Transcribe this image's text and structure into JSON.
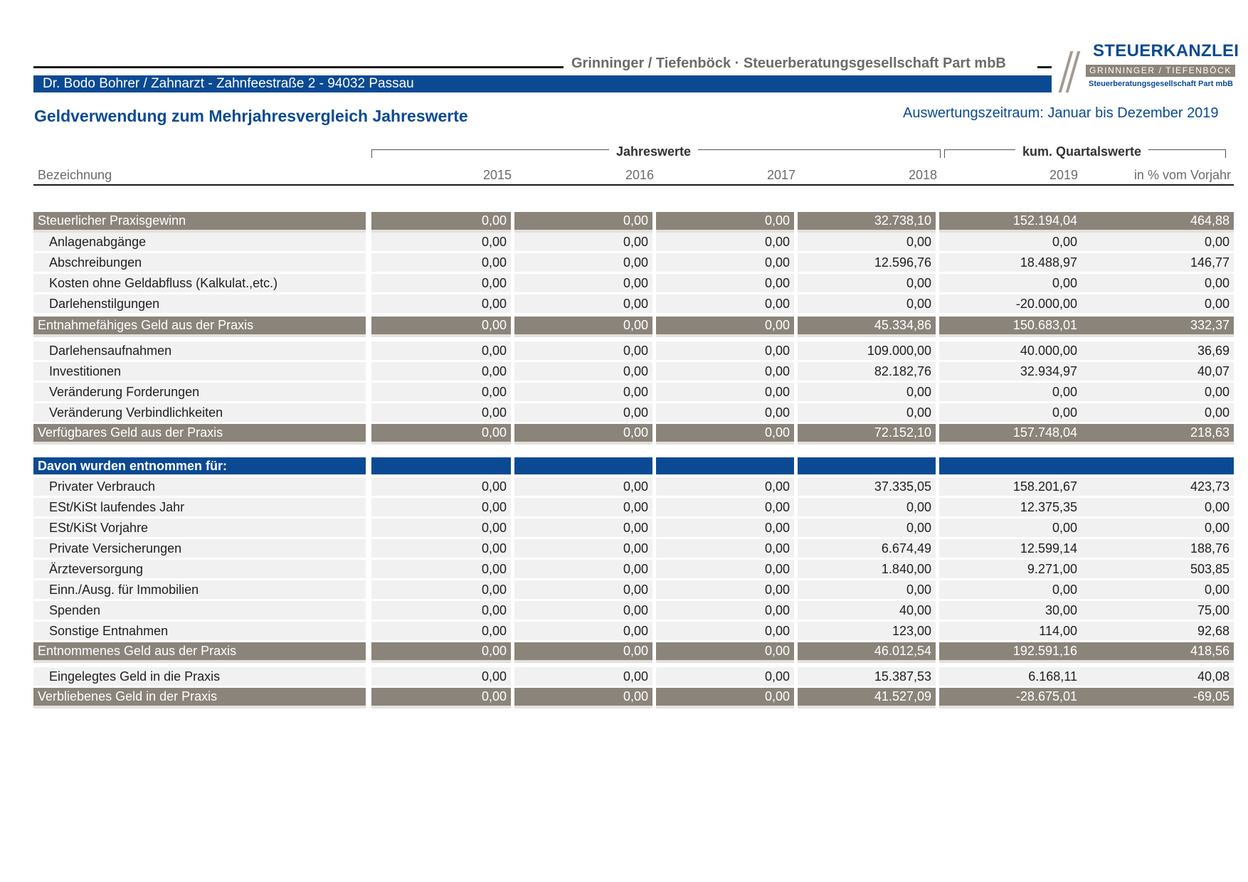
{
  "header": {
    "firm_name": "Grinninger / Tiefenböck · Steuerberatungsgesellschaft Part mbB",
    "client_line": "Dr. Bodo Bohrer / Zahnarzt  -  Zahnfeestraße 2  -  94032 Passau",
    "logo": {
      "title": "STEUERKANZLEI",
      "band": "GRINNINGER / TIEFENBÖCK",
      "sub": "Steuerberatungsgesellschaft Part mbB"
    }
  },
  "report": {
    "title": "Geldverwendung zum Mehrjahresvergleich Jahreswerte",
    "period": "Auswertungszeitraum: Januar bis Dezember 2019"
  },
  "columns": {
    "group_annual": "Jahreswerte",
    "group_quarter": "kum. Quartalswerte",
    "label": "Bezeichnung",
    "years": [
      "2015",
      "2016",
      "2017",
      "2018",
      "2019"
    ],
    "percent": "in % vom Vorjahr"
  },
  "rows": [
    {
      "type": "sum",
      "label": "Steuerlicher Praxisgewinn",
      "values": [
        "0,00",
        "0,00",
        "0,00",
        "32.738,10",
        "152.194,04",
        "464,88"
      ]
    },
    {
      "type": "plain",
      "label": "Anlagenabgänge",
      "values": [
        "0,00",
        "0,00",
        "0,00",
        "0,00",
        "0,00",
        "0,00"
      ]
    },
    {
      "type": "plain",
      "label": "Abschreibungen",
      "values": [
        "0,00",
        "0,00",
        "0,00",
        "12.596,76",
        "18.488,97",
        "146,77"
      ]
    },
    {
      "type": "plain",
      "label": "Kosten ohne Geldabfluss (Kalkulat.,etc.)",
      "values": [
        "0,00",
        "0,00",
        "0,00",
        "0,00",
        "0,00",
        "0,00"
      ]
    },
    {
      "type": "plain",
      "label": "Darlehenstilgungen",
      "values": [
        "0,00",
        "0,00",
        "0,00",
        "0,00",
        "-20.000,00",
        "0,00"
      ]
    },
    {
      "type": "sum",
      "label": "Entnahmefähiges Geld aus der Praxis",
      "values": [
        "0,00",
        "0,00",
        "0,00",
        "45.334,86",
        "150.683,01",
        "332,37"
      ]
    },
    {
      "type": "plain",
      "label": "Darlehensaufnahmen",
      "values": [
        "0,00",
        "0,00",
        "0,00",
        "109.000,00",
        "40.000,00",
        "36,69"
      ]
    },
    {
      "type": "plain",
      "label": "Investitionen",
      "values": [
        "0,00",
        "0,00",
        "0,00",
        "82.182,76",
        "32.934,97",
        "40,07"
      ]
    },
    {
      "type": "plain",
      "label": "Veränderung Forderungen",
      "values": [
        "0,00",
        "0,00",
        "0,00",
        "0,00",
        "0,00",
        "0,00"
      ]
    },
    {
      "type": "plain",
      "label": "Veränderung Verbindlichkeiten",
      "values": [
        "0,00",
        "0,00",
        "0,00",
        "0,00",
        "0,00",
        "0,00"
      ]
    },
    {
      "type": "sum",
      "label": "Verfügbares Geld aus der Praxis",
      "values": [
        "0,00",
        "0,00",
        "0,00",
        "72.152,10",
        "157.748,04",
        "218,63"
      ]
    },
    {
      "type": "section",
      "label": "Davon wurden entnommen für:",
      "values": [
        "",
        "",
        "",
        "",
        "",
        ""
      ]
    },
    {
      "type": "plain",
      "label": "Privater Verbrauch",
      "values": [
        "0,00",
        "0,00",
        "0,00",
        "37.335,05",
        "158.201,67",
        "423,73"
      ]
    },
    {
      "type": "plain",
      "label": "ESt/KiSt laufendes Jahr",
      "values": [
        "0,00",
        "0,00",
        "0,00",
        "0,00",
        "12.375,35",
        "0,00"
      ]
    },
    {
      "type": "plain",
      "label": "ESt/KiSt Vorjahre",
      "values": [
        "0,00",
        "0,00",
        "0,00",
        "0,00",
        "0,00",
        "0,00"
      ]
    },
    {
      "type": "plain",
      "label": "Private Versicherungen",
      "values": [
        "0,00",
        "0,00",
        "0,00",
        "6.674,49",
        "12.599,14",
        "188,76"
      ]
    },
    {
      "type": "plain",
      "label": "Ärzteversorgung",
      "values": [
        "0,00",
        "0,00",
        "0,00",
        "1.840,00",
        "9.271,00",
        "503,85"
      ]
    },
    {
      "type": "plain",
      "label": "Einn./Ausg. für Immobilien",
      "values": [
        "0,00",
        "0,00",
        "0,00",
        "0,00",
        "0,00",
        "0,00"
      ]
    },
    {
      "type": "plain",
      "label": "Spenden",
      "values": [
        "0,00",
        "0,00",
        "0,00",
        "40,00",
        "30,00",
        "75,00"
      ]
    },
    {
      "type": "plain",
      "label": "Sonstige Entnahmen",
      "values": [
        "0,00",
        "0,00",
        "0,00",
        "123,00",
        "114,00",
        "92,68"
      ]
    },
    {
      "type": "sum",
      "label": "Entnommenes Geld aus der Praxis",
      "values": [
        "0,00",
        "0,00",
        "0,00",
        "46.012,54",
        "192.591,16",
        "418,56"
      ]
    },
    {
      "type": "plain",
      "label": "Eingelegtes Geld in die Praxis",
      "values": [
        "0,00",
        "0,00",
        "0,00",
        "15.387,53",
        "6.168,11",
        "40,08"
      ]
    },
    {
      "type": "sum",
      "label": "Verbliebenes Geld in der Praxis",
      "values": [
        "0,00",
        "0,00",
        "0,00",
        "41.527,09",
        "-28.675,01",
        "-69,05"
      ]
    }
  ]
}
